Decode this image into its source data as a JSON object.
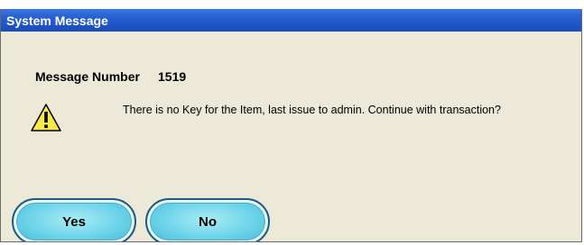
{
  "window": {
    "title": "System Message"
  },
  "message": {
    "number_label": "Message Number",
    "number_value": "1519",
    "text": "There is no Key for the Item, last issue to admin. Continue with transaction?"
  },
  "buttons": {
    "yes_label": "Yes",
    "no_label": "No"
  },
  "icons": {
    "warning": "warning-icon"
  },
  "colors": {
    "titlebar": "#2a63d4",
    "dialog_bg": "#ece9d8",
    "button_fill": "#6cd3e8",
    "warning_yellow": "#f7e94a"
  }
}
